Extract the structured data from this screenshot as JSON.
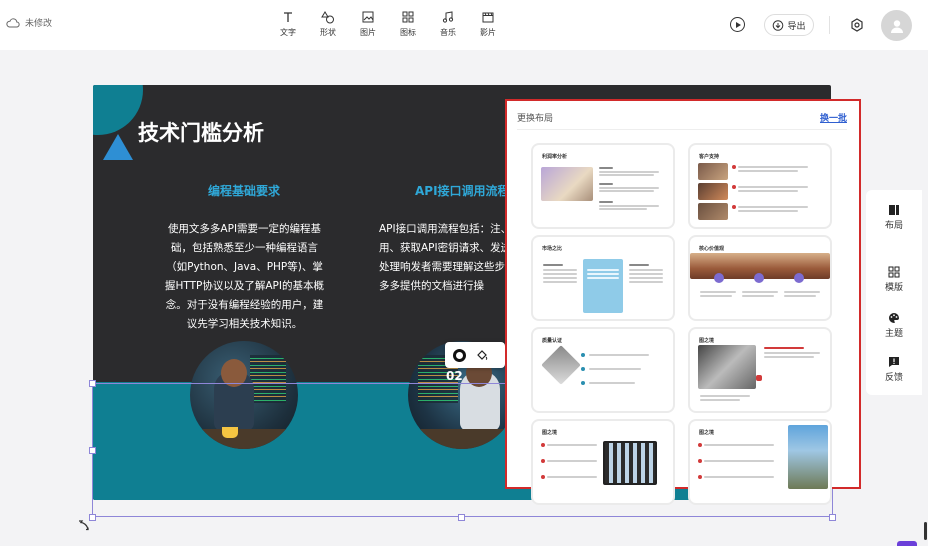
{
  "status": {
    "label": "未修改"
  },
  "toolbar": {
    "items": [
      {
        "label": "文字",
        "icon": "text-icon"
      },
      {
        "label": "形状",
        "icon": "shape-icon"
      },
      {
        "label": "图片",
        "icon": "image-icon"
      },
      {
        "label": "图标",
        "icon": "icon-grid-icon"
      },
      {
        "label": "音乐",
        "icon": "music-icon"
      },
      {
        "label": "影片",
        "icon": "video-icon"
      }
    ],
    "export_label": "导出"
  },
  "slide": {
    "title": "技术门槛分析",
    "columns": [
      {
        "heading": "编程基础要求",
        "body": "使用文多多API需要一定的编程基础，包括熟悉至少一种编程语言（如Python、Java、PHP等)、掌握HTTP协议以及了解API的基本概念。对于没有编程经验的用户，建议先学习相关技术知识。"
      },
      {
        "heading": "API接口调用流程",
        "body": "API接口调用流程包括：注、创建应用、获取API密钥请求、发送请求、处理响发者需要理解这些步骤，文多多提供的文档进行操"
      }
    ],
    "badge_number": "02"
  },
  "layout_panel": {
    "title": "更换布局",
    "refresh_label": "换一批",
    "thumbs": [
      {
        "title": "利润率分析"
      },
      {
        "title": "客户支持"
      },
      {
        "title": "市场之比"
      },
      {
        "title": "核心价值观"
      },
      {
        "title": "质量认证"
      },
      {
        "title": "图之境"
      },
      {
        "title": "图之境"
      },
      {
        "title": "图之境"
      }
    ]
  },
  "dock": {
    "items": [
      {
        "label": "布局",
        "icon": "layout-icon"
      },
      {
        "label": "模版",
        "icon": "template-icon"
      },
      {
        "label": "主题",
        "icon": "palette-icon"
      },
      {
        "label": "反馈",
        "icon": "feedback-icon"
      }
    ]
  },
  "colors": {
    "slide_bg": "#2b2b2d",
    "accent_teal": "#0f7f92",
    "heading_blue": "#2fa8d8",
    "panel_border": "#d22a2a",
    "link_blue": "#2f5fd0",
    "selection": "#8e86d8"
  }
}
